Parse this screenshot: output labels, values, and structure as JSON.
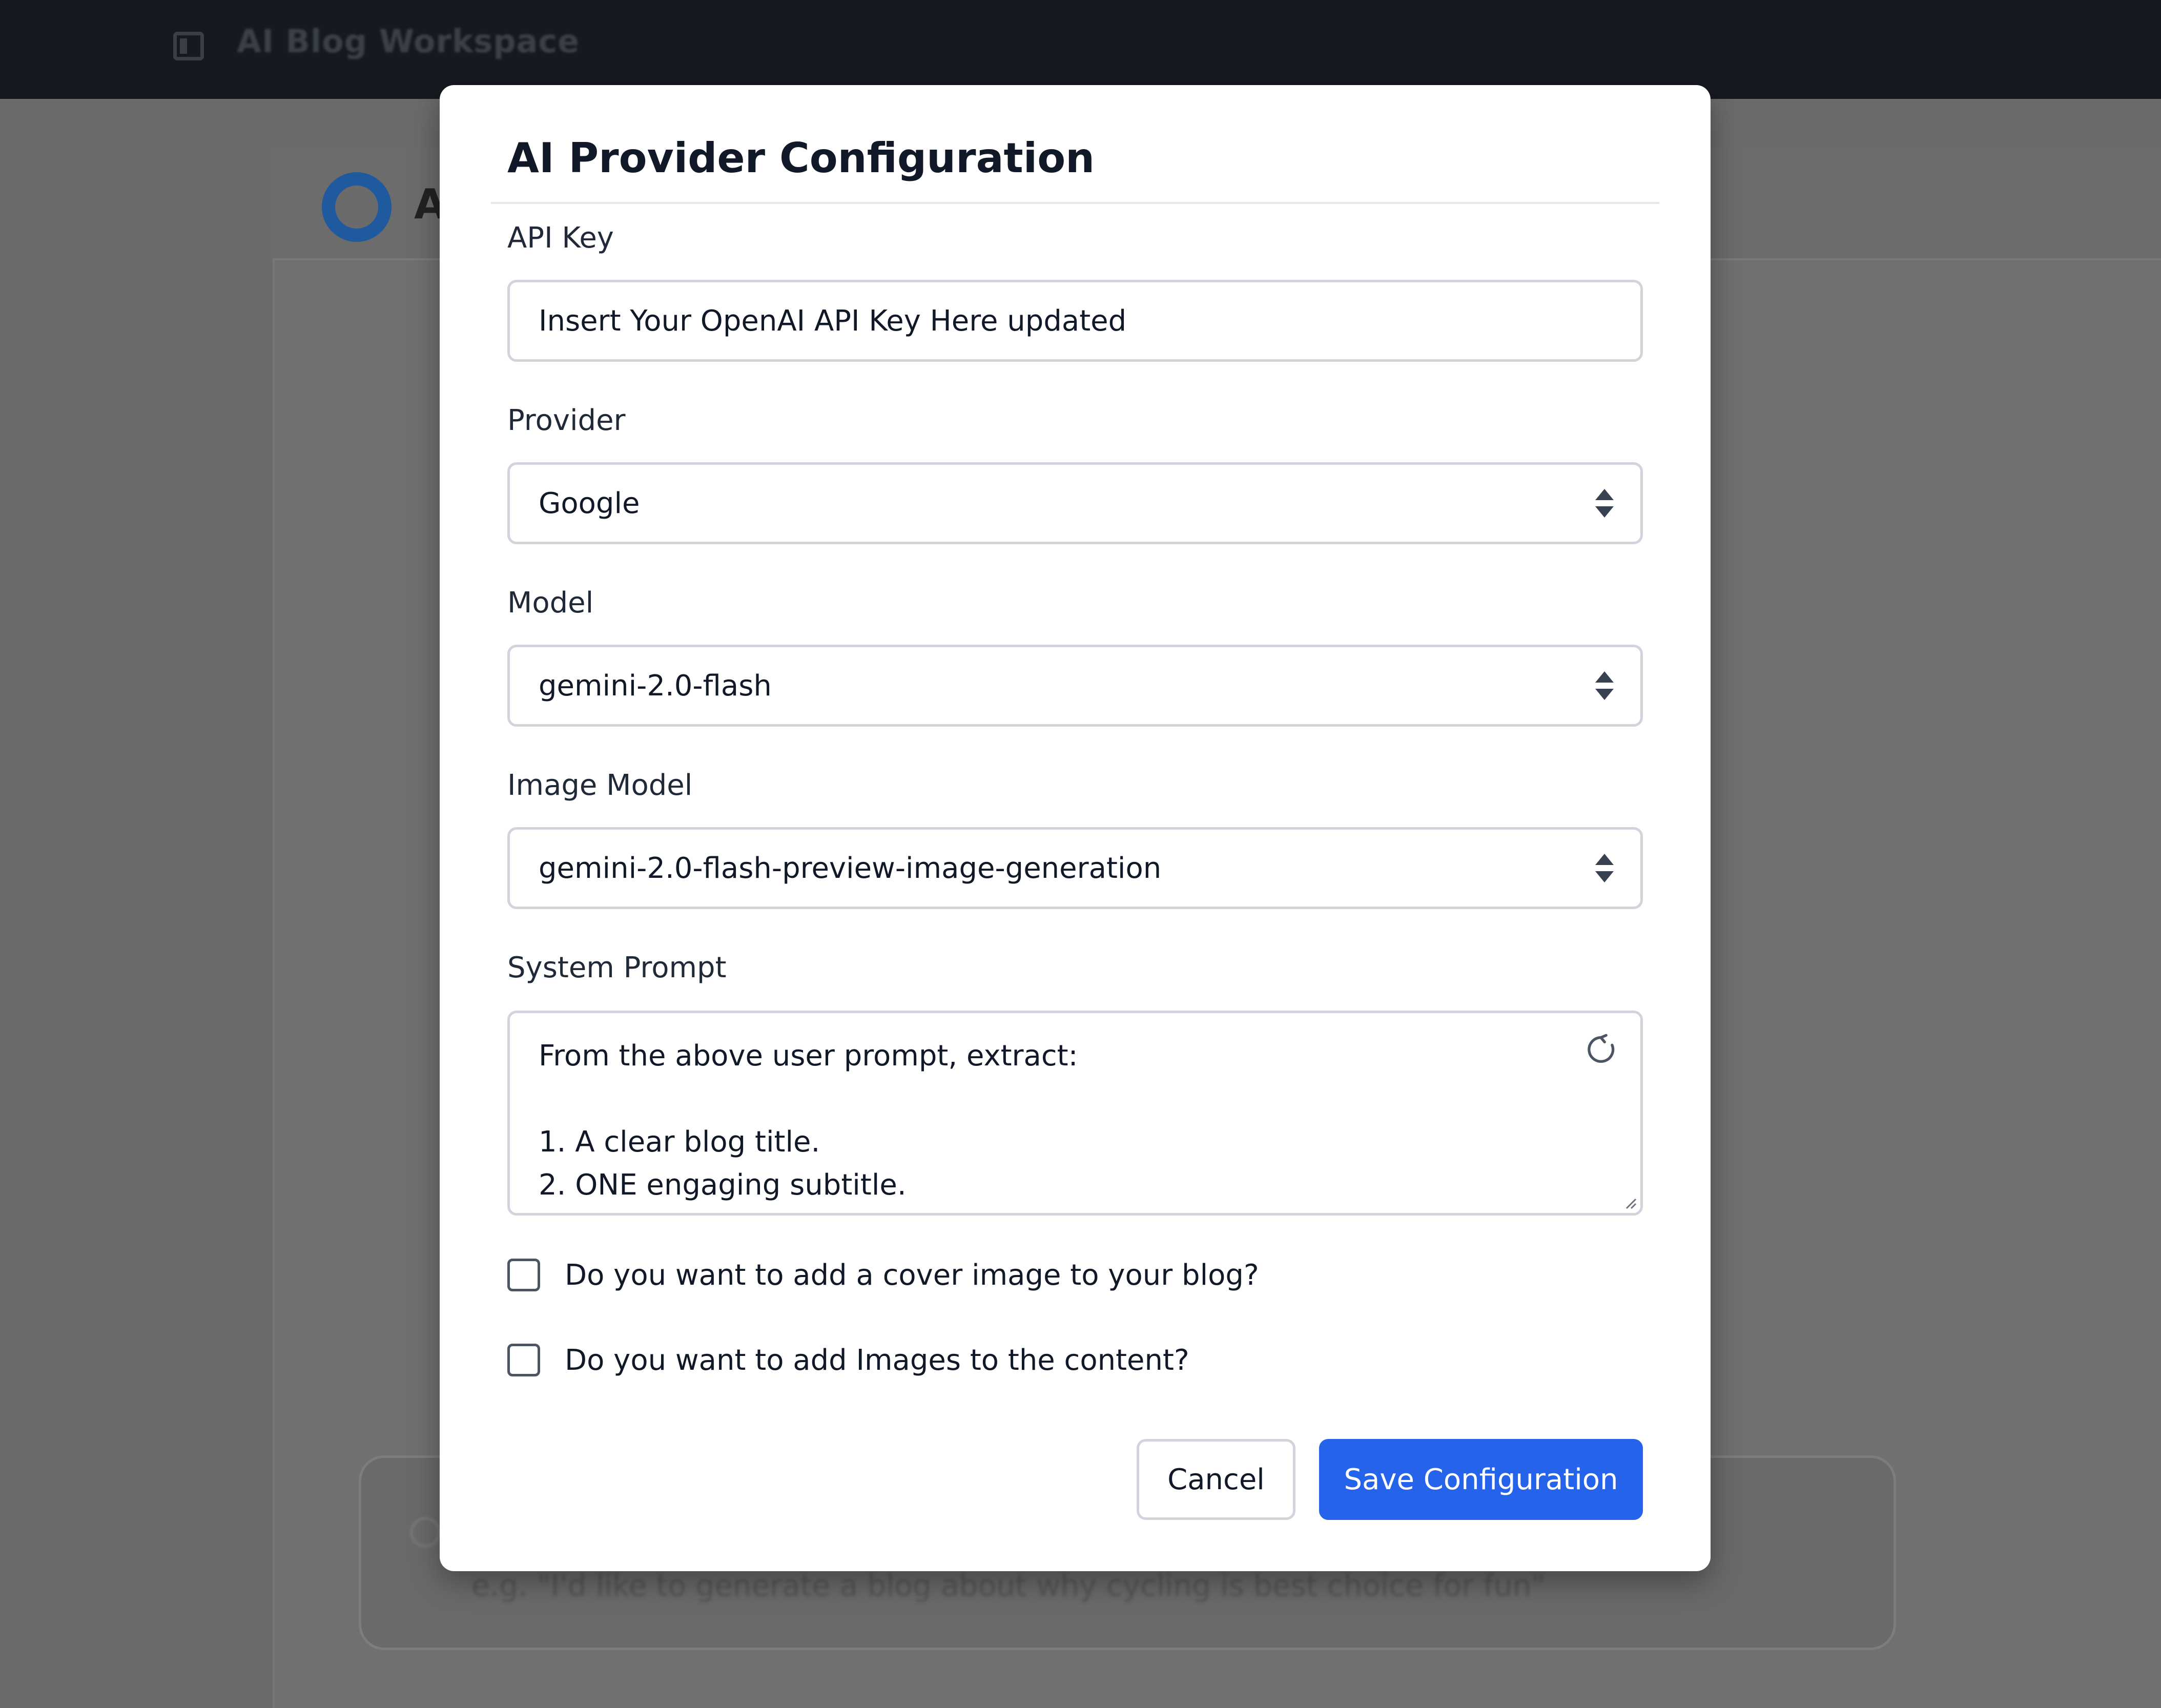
{
  "background_app": {
    "title": "AI Blog Workspace",
    "header_initial": "A",
    "prompt_placeholder": "e.g. \"I'd like to generate a blog about why cycling is best choice for fun\""
  },
  "modal": {
    "title": "AI Provider Configuration",
    "api_key": {
      "label": "API Key",
      "value": "Insert Your OpenAI API Key Here updated"
    },
    "provider": {
      "label": "Provider",
      "value": "Google"
    },
    "model": {
      "label": "Model",
      "value": "gemini-2.0-flash"
    },
    "image_model": {
      "label": "Image Model",
      "value": "gemini-2.0-flash-preview-image-generation"
    },
    "system_prompt": {
      "label": "System Prompt",
      "value": "From the above user prompt, extract:\n\n1. A clear blog title.\n2. ONE engaging subtitle."
    },
    "checkboxes": {
      "cover_image": {
        "label": "Do you want to add a cover image to your blog?",
        "checked": false
      },
      "content_images": {
        "label": "Do you want to add Images to the content?",
        "checked": false
      }
    },
    "buttons": {
      "cancel": "Cancel",
      "save": "Save Configuration"
    }
  },
  "colors": {
    "primary": "#2563eb",
    "topbar": "#161a20",
    "overlay": "#6b6b6b",
    "border": "#d1d5db"
  }
}
